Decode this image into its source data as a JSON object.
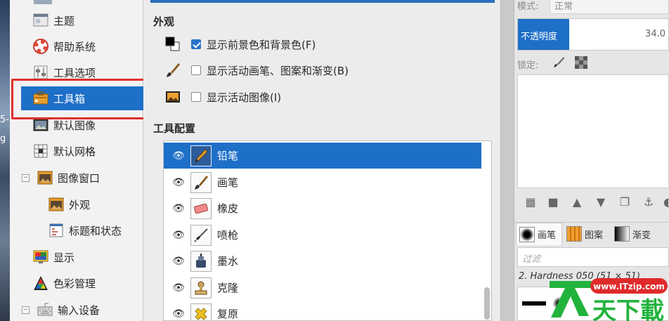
{
  "tree": {
    "items": [
      {
        "label": "主题",
        "icon": "theme-icon"
      },
      {
        "label": "帮助系统",
        "icon": "lifebuoy-icon"
      },
      {
        "label": "工具选项",
        "icon": "sliders-icon"
      },
      {
        "label": "工具箱",
        "icon": "toolbox-icon",
        "selected": true
      },
      {
        "label": "默认图像",
        "icon": "image-icon"
      },
      {
        "label": "默认网格",
        "icon": "grid-icon"
      },
      {
        "label": "图像窗口",
        "icon": "image-window-icon"
      },
      {
        "label": "外观",
        "icon": "image-window-icon"
      },
      {
        "label": "标题和状态",
        "icon": "title-status-icon"
      },
      {
        "label": "显示",
        "icon": "display-icon"
      },
      {
        "label": "色彩管理",
        "icon": "color-management-icon"
      },
      {
        "label": "输入设备",
        "icon": "input-device-icon"
      }
    ]
  },
  "main": {
    "appearance_title": "外观",
    "options": [
      {
        "label": "显示前景色和背景色(F)",
        "checked": true
      },
      {
        "label": "显示活动画笔、图案和渐变(B)",
        "checked": false
      },
      {
        "label": "显示活动图像(I)",
        "checked": false
      }
    ],
    "tool_config_title": "工具配置",
    "tools": [
      {
        "label": "铅笔",
        "icon": "pencil-icon",
        "selected": true
      },
      {
        "label": "画笔",
        "icon": "paintbrush-icon"
      },
      {
        "label": "橡皮",
        "icon": "eraser-icon"
      },
      {
        "label": "喷枪",
        "icon": "airbrush-icon"
      },
      {
        "label": "墨水",
        "icon": "ink-icon"
      },
      {
        "label": "克隆",
        "icon": "clone-stamp-icon"
      },
      {
        "label": "复原",
        "icon": "heal-icon"
      }
    ]
  },
  "dock": {
    "mode_label": "模式:",
    "mode_value": "正常",
    "opacity_label": "不透明度",
    "opacity_value": "34.0",
    "opacity_fraction": 0.34,
    "lock_label": "锁定:",
    "tabs": [
      {
        "label": "画笔"
      },
      {
        "label": "图案"
      },
      {
        "label": "渐变"
      }
    ],
    "filter_placeholder": "过滤",
    "brush_name": "2. Hardness 050 (51 × 51)"
  },
  "desktop": {
    "text1": "5-",
    "text2": "g"
  },
  "watermark": {
    "url": "www.ITzip.com",
    "brand": "天下載"
  },
  "colors": {
    "selection": "#1e6fc8",
    "highlight_box": "#e0302a",
    "watermark_green": "#22b33c"
  }
}
